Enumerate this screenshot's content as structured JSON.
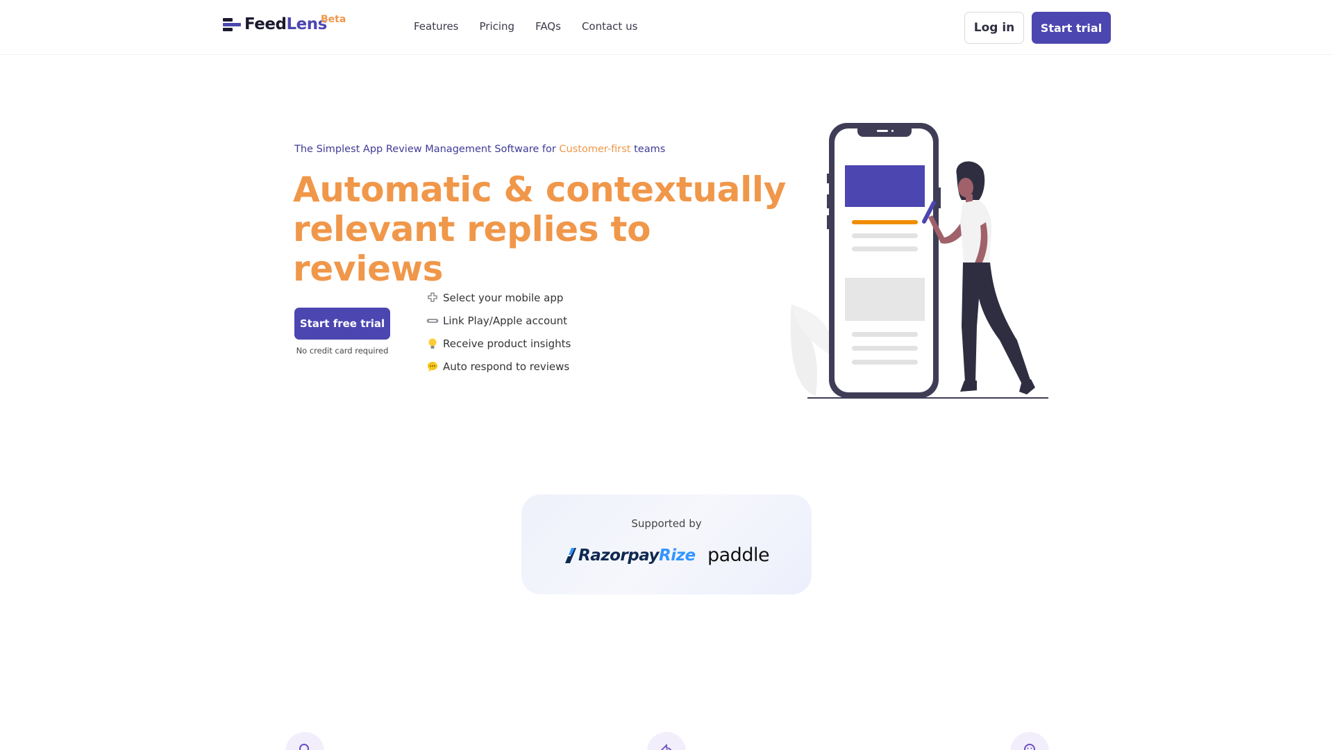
{
  "header": {
    "logo_feed": "Feed",
    "logo_lens": "Lens",
    "logo_beta": "Beta",
    "nav": [
      "Features",
      "Pricing",
      "FAQs",
      "Contact us"
    ],
    "login_label": "Log in",
    "start_trial_label": "Start trial"
  },
  "hero": {
    "tagline_pre": "The Simplest App Review Management Software for ",
    "tagline_highlight": "Customer-first",
    "tagline_post": " teams",
    "headline_line1": "Automatic & contextually",
    "headline_line2": "relevant replies to reviews",
    "cta_label": "Start free trial",
    "cta_note": "No credit card required",
    "steps": [
      {
        "icon": "puzzle-icon",
        "text": "Select your mobile app"
      },
      {
        "icon": "link-icon",
        "text": "Link Play/Apple account"
      },
      {
        "icon": "lightbulb-icon",
        "text": "Receive product insights"
      },
      {
        "icon": "speech-bubble-icon",
        "text": "Auto respond to reviews"
      }
    ]
  },
  "supported": {
    "title": "Supported by",
    "razorpay_part1": "Razorpay",
    "razorpay_part2": "Rize",
    "paddle": "paddle"
  },
  "colors": {
    "primary": "#4b46b0",
    "accent": "#f0974a",
    "dark": "#1b1a2e"
  }
}
